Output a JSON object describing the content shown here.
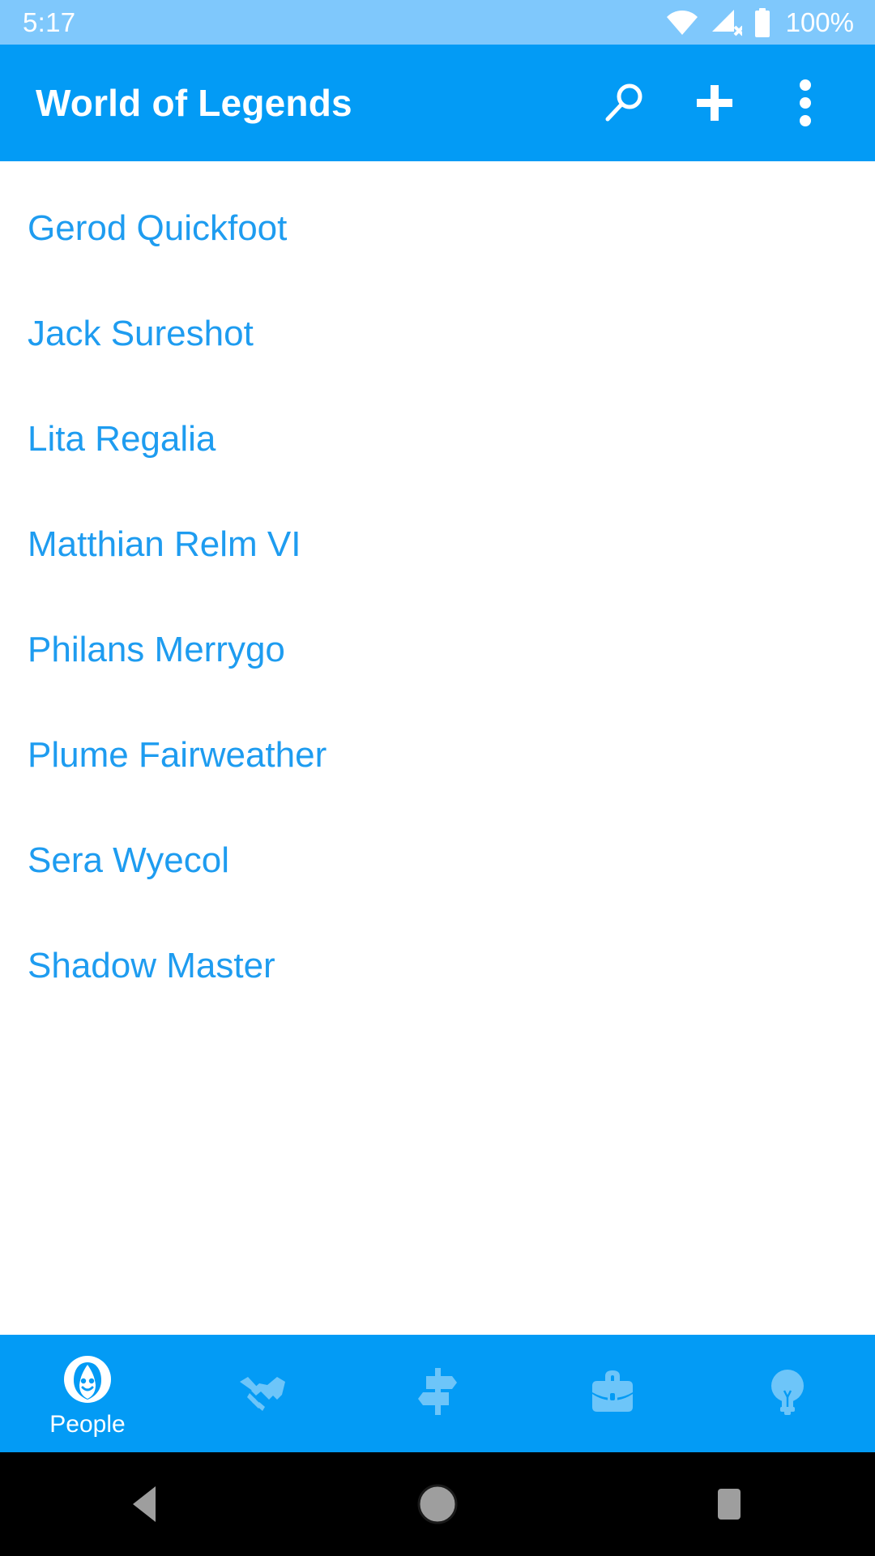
{
  "status_bar": {
    "clock": "5:17",
    "battery_percent": "100%",
    "icons": [
      "wifi-icon",
      "cellular-no-sim-icon",
      "battery-full-icon"
    ],
    "background_color": "#7FC8FC",
    "foreground_color": "#FFFFFF"
  },
  "app_bar": {
    "title": "World of Legends",
    "background_color": "#039BF5",
    "foreground_color": "#FFFFFF",
    "actions": [
      {
        "name": "search-icon",
        "label": "Search"
      },
      {
        "name": "add-icon",
        "label": "Add"
      },
      {
        "name": "overflow-menu-icon",
        "label": "More options"
      }
    ]
  },
  "list": {
    "text_color": "#1E9CF0",
    "items": [
      {
        "label": "Gerod Quickfoot"
      },
      {
        "label": "Jack Sureshot"
      },
      {
        "label": "Lita Regalia"
      },
      {
        "label": "Matthian Relm VI"
      },
      {
        "label": "Philans Merrygo"
      },
      {
        "label": "Plume Fairweather"
      },
      {
        "label": "Sera Wyecol"
      },
      {
        "label": "Shadow Master"
      }
    ]
  },
  "bottom_nav": {
    "background_color": "#039BF5",
    "active_index": 0,
    "tabs": [
      {
        "label": "People",
        "icon": "person-face-icon",
        "active": true
      },
      {
        "label": "",
        "icon": "handshake-icon",
        "active": false
      },
      {
        "label": "",
        "icon": "signpost-icon",
        "active": false
      },
      {
        "label": "",
        "icon": "briefcase-icon",
        "active": false
      },
      {
        "label": "",
        "icon": "lightbulb-icon",
        "active": false
      }
    ]
  },
  "android_nav": {
    "background_color": "#000000",
    "button_color": "#9E9E9E",
    "buttons": [
      {
        "name": "back-button"
      },
      {
        "name": "home-button"
      },
      {
        "name": "recents-button"
      }
    ]
  }
}
